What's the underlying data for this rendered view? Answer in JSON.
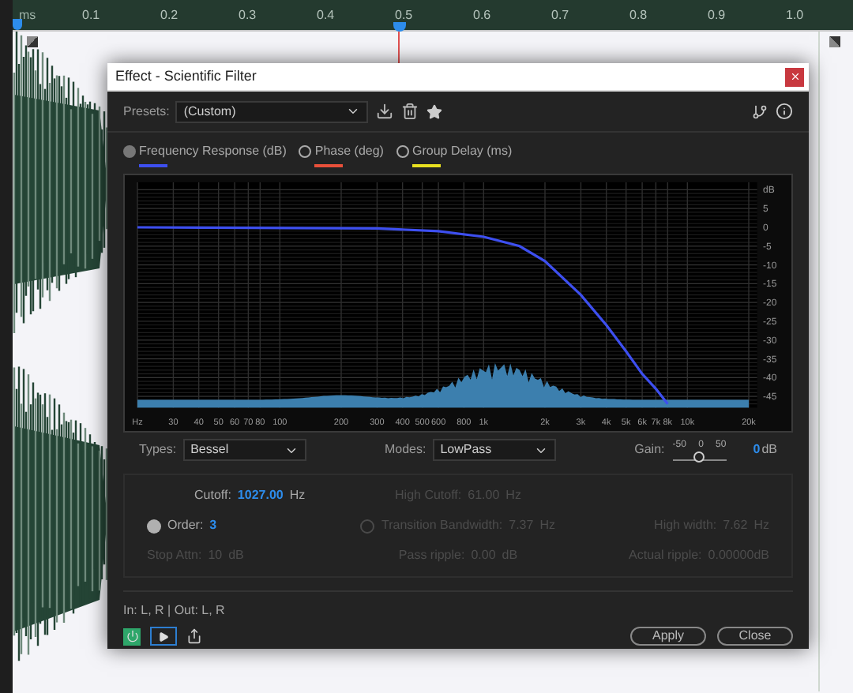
{
  "timeline": {
    "unit": "ms",
    "ticks": [
      "0.1",
      "0.2",
      "0.3",
      "0.4",
      "0.5",
      "0.6",
      "0.7",
      "0.8",
      "0.9",
      "1.0"
    ]
  },
  "dialog": {
    "title": "Effect - Scientific Filter",
    "presets": {
      "label": "Presets:",
      "value": "(Custom)"
    },
    "views": [
      {
        "label": "Frequency Response (dB)",
        "selected": true,
        "color": "#3d4ff0"
      },
      {
        "label": "Phase (deg)",
        "selected": false,
        "color": "#e8503a"
      },
      {
        "label": "Group Delay (ms)",
        "selected": false,
        "color": "#e8e020"
      }
    ],
    "graph": {
      "x_axis_labels": [
        "Hz",
        "30",
        "40",
        "50",
        "60",
        "70",
        "80",
        "100",
        "200",
        "300",
        "400",
        "500",
        "600",
        "800",
        "1k",
        "2k",
        "3k",
        "4k",
        "5k",
        "6k",
        "7k",
        "8k",
        "10k",
        "20k"
      ],
      "y_axis_labels": [
        "dB",
        "5",
        "0",
        "-5",
        "-10",
        "-15",
        "-20",
        "-25",
        "-30",
        "-35",
        "-40",
        "-45"
      ]
    },
    "types": {
      "label": "Types:",
      "value": "Bessel"
    },
    "modes": {
      "label": "Modes:",
      "value": "LowPass"
    },
    "gain": {
      "label": "Gain:",
      "scale": [
        "-50",
        "0",
        "50"
      ],
      "level": 0.5,
      "value": "0",
      "unit": "dB"
    },
    "params": [
      [
        {
          "kind": "text",
          "label": "Cutoff:",
          "value": "1027.00",
          "unit": "Hz",
          "disabled": false
        },
        {
          "kind": "text",
          "label": "High Cutoff:",
          "value": "61.00",
          "unit": "Hz",
          "disabled": true
        }
      ],
      [
        {
          "kind": "radio",
          "label": "Order:",
          "value": "3",
          "disabled": false,
          "selected": true
        },
        {
          "kind": "radio",
          "label": "Transition Bandwidth:",
          "value": "7.37",
          "unit": "Hz",
          "disabled": true,
          "selected": false
        },
        {
          "kind": "text",
          "label": "High width:",
          "value": "7.62",
          "unit": "Hz",
          "disabled": true
        }
      ],
      [
        {
          "kind": "text",
          "label": "Stop Attn:",
          "value": "10",
          "unit": "dB",
          "disabled": true
        },
        {
          "kind": "text",
          "label": "Pass ripple:",
          "value": "0.00",
          "unit": "dB",
          "disabled": true
        },
        {
          "kind": "text",
          "label": "Actual ripple:",
          "value": "0.00000dB",
          "disabled": true
        }
      ]
    ],
    "routing": "In: L, R | Out: L, R",
    "power": {
      "on": true
    },
    "buttons": [
      "Apply",
      "Close"
    ]
  }
}
